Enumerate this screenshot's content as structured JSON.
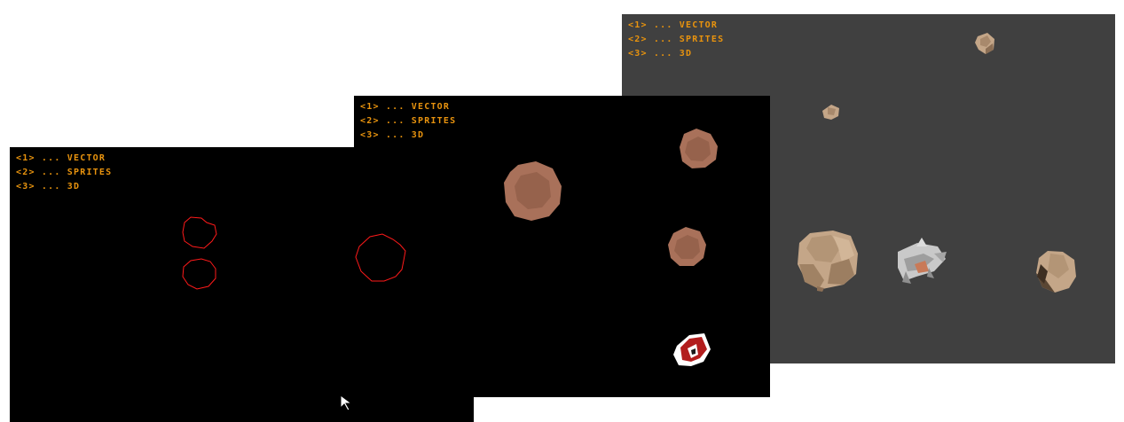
{
  "menu_color": "#e8930e",
  "menu_items": [
    {
      "key": "<1>",
      "label": "VECTOR"
    },
    {
      "key": "<2>",
      "label": "SPRITES"
    },
    {
      "key": "<3>",
      "label": "3D"
    }
  ],
  "windows": {
    "vector": {
      "mode": "VECTOR",
      "background": "#000000",
      "asteroid_outline_color": "#ff1a1a",
      "asteroid_count": 3
    },
    "sprites": {
      "mode": "SPRITES",
      "background": "#000000",
      "asteroid_color": "#a9715a",
      "asteroid_count": 3,
      "ship_colors": [
        "#b21d1d",
        "#ffffff"
      ]
    },
    "three_d": {
      "mode": "3D",
      "background": "#404040",
      "asteroid_color": "#c4a688",
      "asteroid_count": 5,
      "ship_color": "#b9b9b9"
    }
  },
  "cursor": "arrow-cursor-icon"
}
